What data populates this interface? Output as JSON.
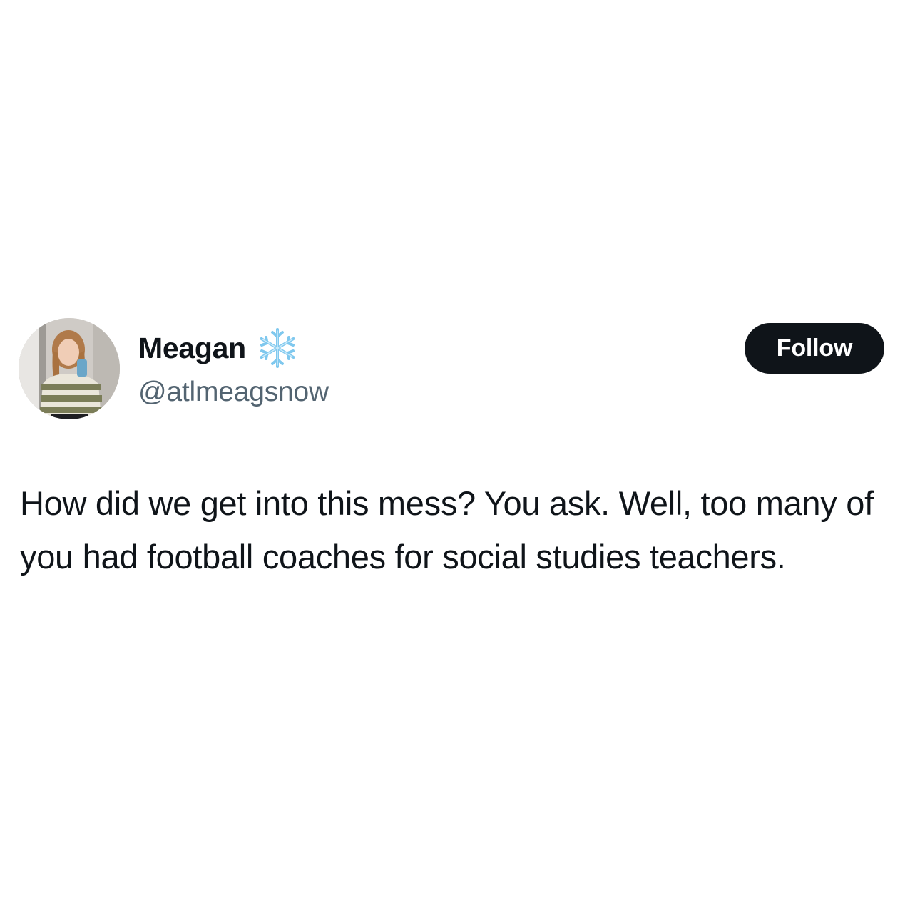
{
  "tweet": {
    "author": {
      "display_name": "Meagan",
      "badge_icon": "snowflake-icon",
      "handle": "@atlmeagsnow"
    },
    "follow_label": "Follow",
    "text": "How did we get into this mess? You ask. Well, too many of you had football coaches for social studies teachers."
  },
  "colors": {
    "background": "#ffffff",
    "text_primary": "#0f1419",
    "text_secondary": "#536471",
    "button_bg": "#0f1419",
    "button_text": "#ffffff",
    "snowflake": "#7fc8ee"
  }
}
